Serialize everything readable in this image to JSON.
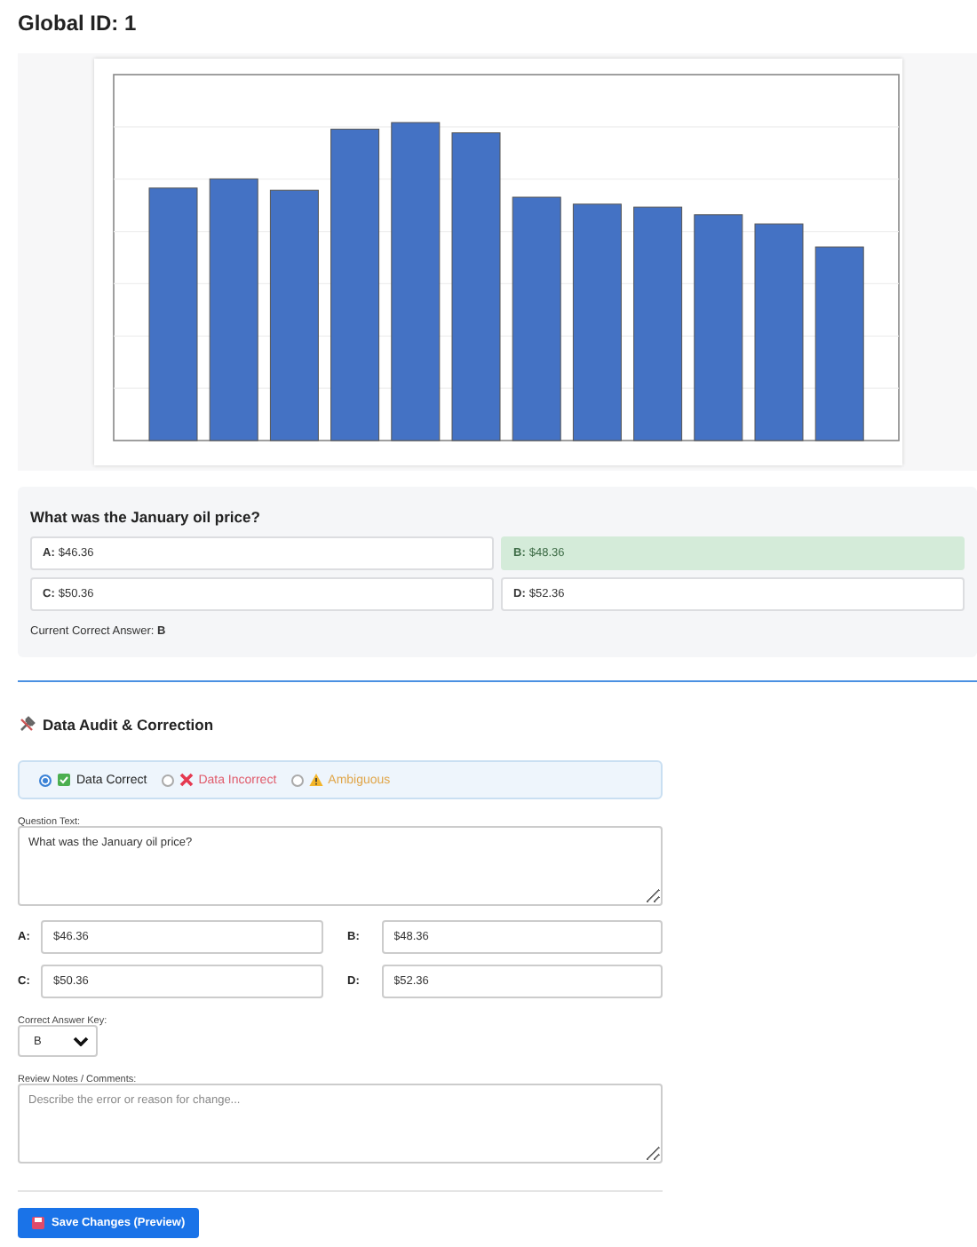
{
  "title": "Global ID: 1",
  "question": {
    "text": "What was the January oil price?",
    "options": [
      {
        "key": "A:",
        "value": "$46.36",
        "selected": false
      },
      {
        "key": "B:",
        "value": "$48.36",
        "selected": true
      },
      {
        "key": "C:",
        "value": "$50.36",
        "selected": false
      },
      {
        "key": "D:",
        "value": "$52.36",
        "selected": false
      }
    ],
    "correct_label": "Current Correct Answer:",
    "correct_value": "B"
  },
  "audit": {
    "title": "Data Audit & Correction",
    "verdicts": [
      {
        "label": "Data Correct",
        "kind": "correct",
        "selected": true
      },
      {
        "label": "Data Incorrect",
        "kind": "incorrect",
        "selected": false
      },
      {
        "label": "Ambiguous",
        "kind": "ambiguous",
        "selected": false
      }
    ],
    "question_label": "Question Text:",
    "question_value": "What was the January oil price?",
    "answers": [
      {
        "key": "A:",
        "value": "$46.36"
      },
      {
        "key": "B:",
        "value": "$48.36"
      },
      {
        "key": "C:",
        "value": "$50.36"
      },
      {
        "key": "D:",
        "value": "$52.36"
      }
    ],
    "key_label": "Correct Answer Key:",
    "key_value": "B",
    "notes_label": "Review Notes / Comments:",
    "notes_placeholder": "Describe the error or reason for change...",
    "save": "Save Changes (Preview)"
  }
}
